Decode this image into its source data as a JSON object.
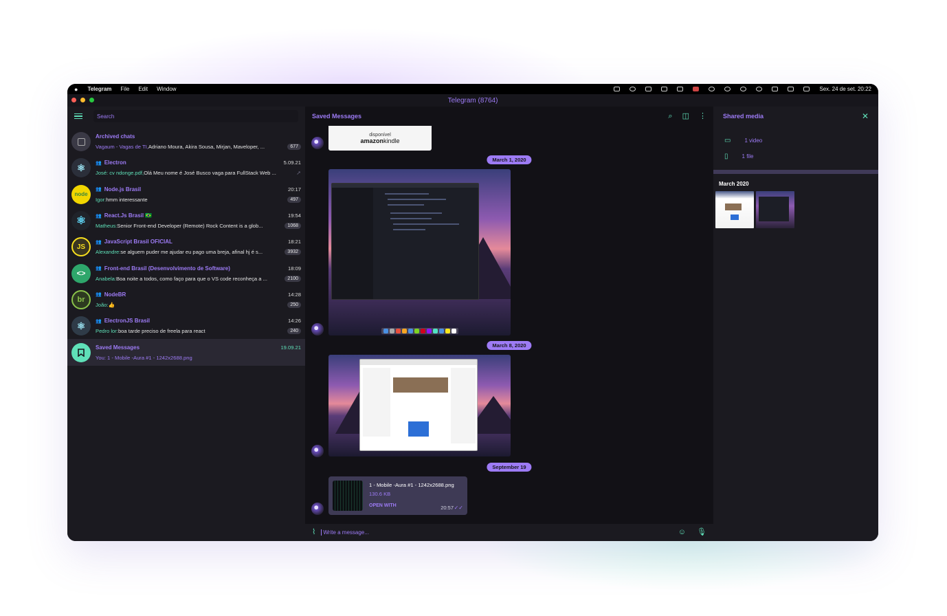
{
  "menubar": {
    "app": "Telegram",
    "items": [
      "File",
      "Edit",
      "Window"
    ],
    "clock": "Sex. 24 de set.  20:22"
  },
  "window": {
    "title": "Telegram (8764)"
  },
  "sidebar": {
    "search_placeholder": "Search",
    "chats": [
      {
        "name": "Archived chats",
        "time": "",
        "sender": "Vagaum - Vagas de TI,",
        "preview": " Adriano Moura, Akira Sousa, Mirjan, Maveloper, ...",
        "badge": "677"
      },
      {
        "name": "Electron",
        "time": "5.09.21",
        "sender": "José: cv ndonge.pdf,",
        "preview": " Olá Meu nome é José Busco vaga para FullStack Web ...",
        "badge": ""
      },
      {
        "name": "Node.js Brasil",
        "time": "20:17",
        "sender": "Igor:",
        "preview": " hmm interessante",
        "badge": "497"
      },
      {
        "name": "React.Js Brasil 🇧🇷",
        "time": "19:54",
        "sender": "Matheus:",
        "preview": " Senior Front-end Developer (Remote)  Rock Content is a glob...",
        "badge": "1068"
      },
      {
        "name": "JavaScript Brasil OFICIAL",
        "time": "18:21",
        "sender": "Alexandre:",
        "preview": " se alguem puder me ajudar eu pago uma breja, afinal hj é s...",
        "badge": "3932"
      },
      {
        "name": "Front-end Brasil (Desenvolvimento de Software)",
        "time": "18:09",
        "sender": "Anabela:",
        "preview": " Boa noite a todos, como faço para que o VS code reconheça a ...",
        "badge": "2100"
      },
      {
        "name": "NodeBR",
        "time": "14:28",
        "sender": "João:",
        "preview": " 👍",
        "badge": "250"
      },
      {
        "name": "ElectronJS Brasil",
        "time": "14:26",
        "sender": "Pedro lor:",
        "preview": " boa tarde preciso de freela para react",
        "badge": "240"
      },
      {
        "name": "Saved Messages",
        "time": "19.09.21",
        "sender": "",
        "preview": "You: 1 - Mobile -Aura #1 - 1242x2688.png",
        "badge": ""
      }
    ]
  },
  "chat": {
    "title": "Saved Messages",
    "kindle_line1": "disponível",
    "kindle_line2": "amazon",
    "kindle_line3": "kindle",
    "dates": [
      "March 1, 2020",
      "March 8, 2020",
      "September 19"
    ],
    "file": {
      "name": "1 - Mobile -Aura #1 - 1242x2688.png",
      "size": "130.6 KB",
      "action": "OPEN WITH",
      "time": "20:57"
    },
    "composer_placeholder": "Write a message..."
  },
  "shared_media": {
    "title": "Shared media",
    "items": [
      "1 video",
      "1 file"
    ],
    "month": "March 2020"
  },
  "colors": {
    "accent_purple": "#9d7bf5",
    "accent_green": "#5fe0b8",
    "background": "#17161c"
  }
}
